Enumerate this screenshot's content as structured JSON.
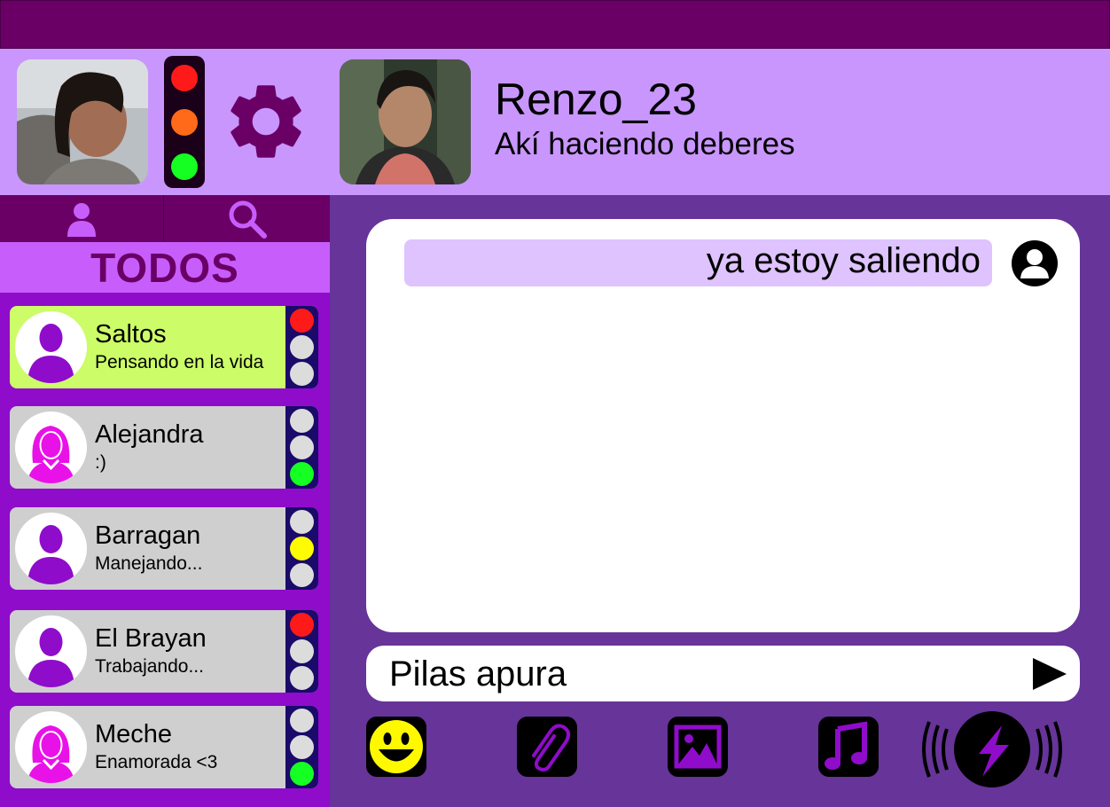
{
  "header": {
    "contact_name": "Renzo_23",
    "contact_status": "Akí haciendo deberes",
    "status_light": "green",
    "accent": "#c996fd",
    "brand": "#6a0066"
  },
  "icons": {
    "settings": "gear-icon",
    "contacts_tab": "person-icon",
    "search_tab": "search-icon",
    "send": "send-arrow-icon",
    "emoji": "smiley-icon",
    "attach": "paperclip-icon",
    "image": "image-icon",
    "music": "music-note-icon",
    "buzz": "lightning-buzz-icon"
  },
  "sidebar": {
    "filter_label": "TODOS",
    "contacts": [
      {
        "name": "Saltos",
        "status": "Pensando en la vida",
        "gender": "male",
        "light": "red",
        "active": true
      },
      {
        "name": "Alejandra",
        "status": ":)",
        "gender": "female",
        "light": "green",
        "active": false
      },
      {
        "name": "Barragan",
        "status": "Manejando...",
        "gender": "male",
        "light": "yellow",
        "active": false
      },
      {
        "name": "El Brayan",
        "status": "Trabajando...",
        "gender": "male",
        "light": "red",
        "active": false
      },
      {
        "name": "Meche",
        "status": "Enamorada <3",
        "gender": "female",
        "light": "green",
        "active": false
      }
    ]
  },
  "chat": {
    "messages": [
      {
        "text": "ya estoy saliendo"
      }
    ],
    "input_value": "Pilas apura"
  }
}
